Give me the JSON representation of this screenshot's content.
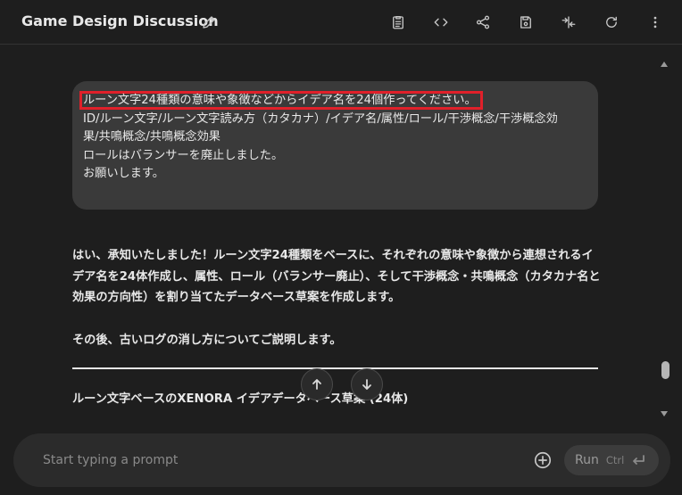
{
  "header": {
    "title": "Game Design Discussion",
    "icons": [
      "edit-icon",
      "notes-icon",
      "code-icon",
      "share-icon",
      "save-icon",
      "compare-icon",
      "refresh-icon",
      "more-vert-icon"
    ]
  },
  "user_message": {
    "highlighted_line": "ルーン文字24種類の意味や象徴などからイデア名を24個作ってください。",
    "line2": "ID/ルーン文字/ルーン文字読み方（カタカナ）/イデア名/属性/ロール/干渉概念/干渉概念効",
    "line3": "果/共鳴概念/共鳴概念効果",
    "line4": "ロールはバランサーを廃止しました。",
    "line5": "お願いします。",
    "highlight_color": "#e0202a"
  },
  "model_response": {
    "paragraph1": "はい、承知いたしました！ルーン文字24種類をベースに、それぞれの意味や象徴から連想されるイデア名を24体作成し、属性、ロール（バランサー廃止）、そして干渉概念・共鳴概念（カタカナ名と効果の方向性）を割り当てたデータベース草案を作成します。",
    "paragraph2": "その後、古いログの消し方についてご説明します。",
    "section_heading": "ルーン文字ベースのXENORA イデアデータベース草案 (24体)"
  },
  "composer": {
    "placeholder": "Start typing a prompt",
    "run_label": "Run",
    "run_shortcut": "Ctrl"
  }
}
